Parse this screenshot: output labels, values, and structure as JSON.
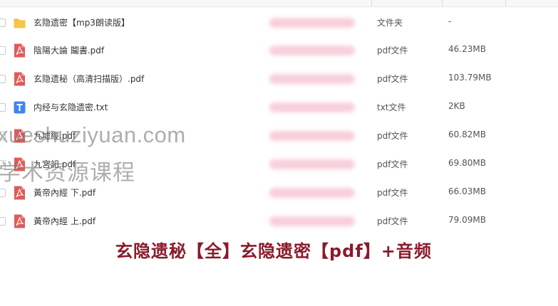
{
  "files": [
    {
      "name": "玄隐遗密【mp3朗读版】",
      "type": "文件夹",
      "size": "-",
      "icon": "folder-icon"
    },
    {
      "name": "陰陽大論 鬮書.pdf",
      "type": "pdf文件",
      "size": "46.23MB",
      "icon": "pdf-icon"
    },
    {
      "name": "玄隐遗秘（高清扫描版）.pdf",
      "type": "pdf文件",
      "size": "103.79MB",
      "icon": "pdf-icon"
    },
    {
      "name": "内经与玄隐遗密.txt",
      "type": "txt文件",
      "size": "2KB",
      "icon": "txt-icon"
    },
    {
      "name": "九墟經.pdf",
      "type": "pdf文件",
      "size": "60.82MB",
      "icon": "pdf-icon"
    },
    {
      "name": "九宮記.pdf",
      "type": "pdf文件",
      "size": "69.80MB",
      "icon": "pdf-icon"
    },
    {
      "name": "黃帝內經 下.pdf",
      "type": "pdf文件",
      "size": "66.03MB",
      "icon": "pdf-icon"
    },
    {
      "name": "黃帝內經 上.pdf",
      "type": "pdf文件",
      "size": "79.09MB",
      "icon": "pdf-icon"
    }
  ],
  "watermark": {
    "line1": "xueshuziyuan.com",
    "line2": "学术资源课程"
  },
  "caption": "玄隐遗秘【全】玄隐遗密【pdf】+音频",
  "colors": {
    "folder": "#f5b82e",
    "pdf": "#e15a5a",
    "txt": "#3b86f0",
    "caption": "#8b1a2b"
  }
}
